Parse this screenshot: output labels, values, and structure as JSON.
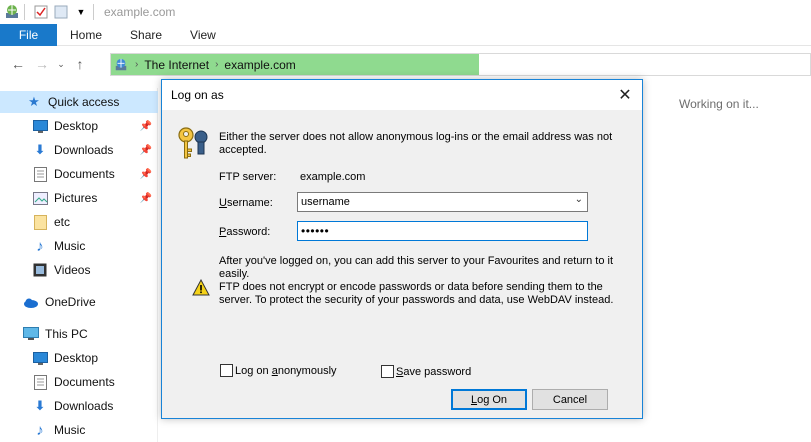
{
  "window": {
    "title": "example.com"
  },
  "ribbon": {
    "file": "File",
    "tabs": [
      "Home",
      "Share",
      "View"
    ]
  },
  "address": {
    "crumbs": [
      "The Internet",
      "example.com"
    ],
    "fill_color": "#8fda8f"
  },
  "status": {
    "working": "Working on it..."
  },
  "sidebar": {
    "items": [
      {
        "label": "Quick access",
        "icon": "star-icon",
        "pinned": false,
        "selected": true
      },
      {
        "label": "Desktop",
        "icon": "desktop-icon",
        "pinned": true
      },
      {
        "label": "Downloads",
        "icon": "download-arrow-icon",
        "pinned": true
      },
      {
        "label": "Documents",
        "icon": "documents-icon",
        "pinned": true
      },
      {
        "label": "Pictures",
        "icon": "pictures-icon",
        "pinned": true
      },
      {
        "label": "etc",
        "icon": "folder-icon",
        "pinned": false
      },
      {
        "label": "Music",
        "icon": "music-note-icon",
        "pinned": false
      },
      {
        "label": "Videos",
        "icon": "film-icon",
        "pinned": false
      },
      {
        "label": "OneDrive",
        "icon": "cloud-icon",
        "pinned": false
      },
      {
        "label": "This PC",
        "icon": "computer-icon",
        "pinned": false
      },
      {
        "label": "Desktop",
        "icon": "desktop-icon",
        "pinned": false
      },
      {
        "label": "Documents",
        "icon": "documents-icon",
        "pinned": false
      },
      {
        "label": "Downloads",
        "icon": "download-arrow-icon",
        "pinned": false
      },
      {
        "label": "Music",
        "icon": "music-note-icon",
        "pinned": false
      }
    ]
  },
  "dialog": {
    "title": "Log on as",
    "message": "Either the server does not allow anonymous log-ins or the email address was not accepted.",
    "ftp_server_label": "FTP server:",
    "ftp_server_value": "example.com",
    "username_label_pre": "",
    "username_label_u": "U",
    "username_label_post": "sername:",
    "username_value": "username",
    "password_label_u": "P",
    "password_label_post": "assword:",
    "password_value": "••••••",
    "info1": "After you've logged on, you can add this server to your Favourites and return to it easily.",
    "info2": "FTP does not encrypt or encode passwords or data before sending them to the server. To protect the security of your passwords and data, use WebDAV instead.",
    "anon_label_pre": "Log on ",
    "anon_label_u": "a",
    "anon_label_post": "nonymously",
    "save_label_u": "S",
    "save_label_post": "ave password",
    "logon_u": "L",
    "logon_post": "og On",
    "cancel": "Cancel"
  }
}
